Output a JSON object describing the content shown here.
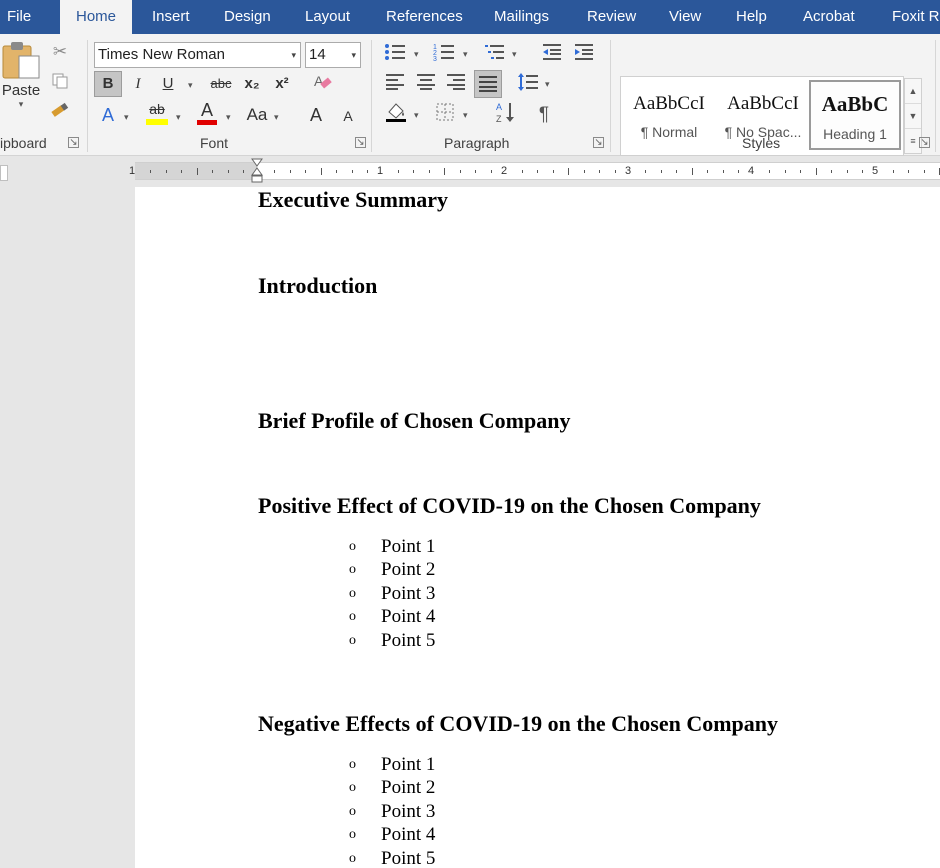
{
  "tabs": [
    "File",
    "Home",
    "Insert",
    "Design",
    "Layout",
    "References",
    "Mailings",
    "Review",
    "View",
    "Help",
    "Acrobat",
    "Foxit Re"
  ],
  "active_tab": "Home",
  "clipboard": {
    "paste_label": "Paste",
    "group_label": "ipboard"
  },
  "font": {
    "family": "Times New Roman",
    "size": "14",
    "bold": "B",
    "italic": "I",
    "underline": "U",
    "strikethrough": "abc",
    "subscript": "x₂",
    "superscript": "x²",
    "highlight": "ab",
    "font_color": "A",
    "change_case": "Aa",
    "grow": "A",
    "shrink": "A",
    "group_label": "Font",
    "highlight_color": "#ffff00",
    "font_color_value": "#e00000"
  },
  "paragraph": {
    "pilcrow": "¶",
    "group_label": "Paragraph"
  },
  "styles": {
    "group_label": "Styles",
    "items": [
      {
        "sample": "AaBbCcI",
        "name": "¶ Normal"
      },
      {
        "sample": "AaBbCcI",
        "name": "¶ No Spac..."
      },
      {
        "sample": "AaBbC",
        "name": "Heading 1"
      }
    ]
  },
  "ruler": {
    "numbers": [
      "1",
      "1",
      "2",
      "3",
      "4",
      "5"
    ]
  },
  "document": {
    "headings": [
      "Executive Summary",
      "Introduction",
      "Brief Profile of Chosen Company",
      "Positive Effect of COVID-19 on the Chosen Company",
      "Negative Effects of COVID-19 on the Chosen Company"
    ],
    "bullet_marker": "o",
    "list_positive": [
      "Point 1",
      "Point 2",
      "Point 3",
      "Point 4",
      "Point 5"
    ],
    "list_negative": [
      "Point 1",
      "Point 2",
      "Point 3",
      "Point 4",
      "Point 5"
    ]
  },
  "colors": {
    "accent": "#2b579a",
    "ribbon_bg": "#f3f3f3",
    "canvas_bg": "#e6e6e6"
  }
}
